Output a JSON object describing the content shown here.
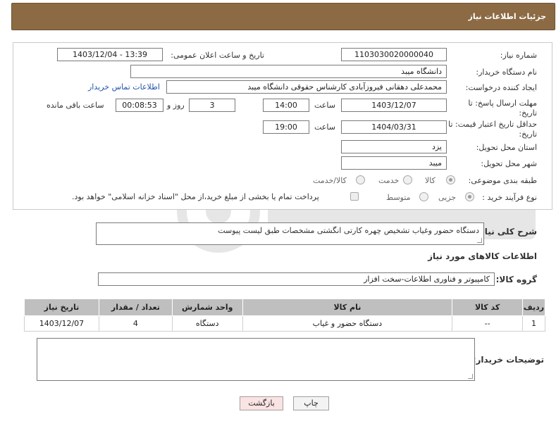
{
  "header": {
    "title": "جزئیات اطلاعات نیاز"
  },
  "fields": {
    "need_number_label": "شماره نیاز:",
    "need_number": "1103030020000040",
    "announce_label": "تاریخ و ساعت اعلان عمومی:",
    "announce_value": "1403/12/04 - 13:39",
    "buyer_org_label": "نام دستگاه خریدار:",
    "buyer_org": "دانشگاه میبد",
    "creator_label": "ایجاد کننده درخواست:",
    "creator": "محمدعلی دهقانی فیروزآبادی کارشناس حقوقی دانشگاه میبد",
    "contact_link": "اطلاعات تماس خریدار",
    "deadline_label_1": "مهلت ارسال پاسخ: تا",
    "deadline_label_2": "تاریخ:",
    "deadline_date": "1403/12/07",
    "time_label": "ساعت",
    "deadline_time": "14:00",
    "days_value": "3",
    "days_label": "روز و",
    "remaining_value": "00:08:53",
    "remaining_label": "ساعت باقی مانده",
    "validity_label_1": "حداقل تاریخ اعتبار قیمت: تا",
    "validity_label_2": "تاریخ:",
    "validity_date": "1404/03/31",
    "validity_time_label": "ساعت",
    "validity_time": "19:00",
    "province_label": "استان محل تحویل:",
    "province": "یزد",
    "city_label": "شهر محل تحویل:",
    "city": "میبد",
    "category_label": "طبقه بندی موضوعی:",
    "category_options": [
      "کالا",
      "خدمت",
      "کالا/خدمت"
    ],
    "process_label": "نوع فرآیند خرید :",
    "process_options": [
      "جزیی",
      "متوسط"
    ],
    "payment_note": "پرداخت تمام یا بخشی از مبلغ خرید،از محل \"اسناد خزانه اسلامی\" خواهد بود."
  },
  "description": {
    "label": "شرح کلی نیاز:",
    "text": "دستگاه حضور وغیاب تشخیص  چهره کارتی انگشتی مشخصات طبق لیست پیوست"
  },
  "goods": {
    "section_title": "اطلاعات کالاهای مورد نیاز",
    "group_label": "گروه کالا:",
    "group_value": "کامپیوتر و فناوری اطلاعات-سخت افزار",
    "columns": [
      "ردیف",
      "کد کالا",
      "نام کالا",
      "واحد شمارش",
      "تعداد / مقدار",
      "تاریخ نیاز"
    ],
    "rows": [
      [
        "1",
        "--",
        "دستگاه حضور و غیاب",
        "دستگاه",
        "4",
        "1403/12/07"
      ]
    ]
  },
  "buyer_notes": {
    "label": "توضیحات خریدار:"
  },
  "buttons": {
    "print": "چاپ",
    "back": "بازگشت"
  },
  "colors": {
    "header_bg": "#8b6a44",
    "table_header_bg": "#bfbfbf",
    "back_button_bg": "#fbe3e3"
  }
}
